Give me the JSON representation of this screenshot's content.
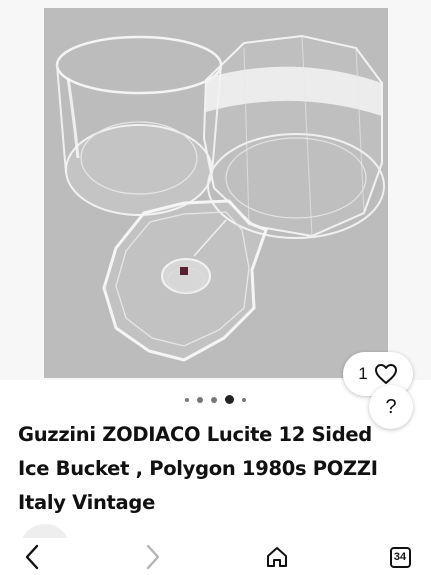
{
  "gallery": {
    "dots_total": 5,
    "active_index": 3,
    "like_count": "1",
    "help_label": "?"
  },
  "listing": {
    "title": "Guzzini ZODIACO Lucite 12 Sided Ice Bucket , Polygon 1980s POZZI Italy Vintage"
  },
  "nav": {
    "tabs_count": "34"
  },
  "colors": {
    "photo_background": "#bcbcbc",
    "text": "#111111"
  }
}
